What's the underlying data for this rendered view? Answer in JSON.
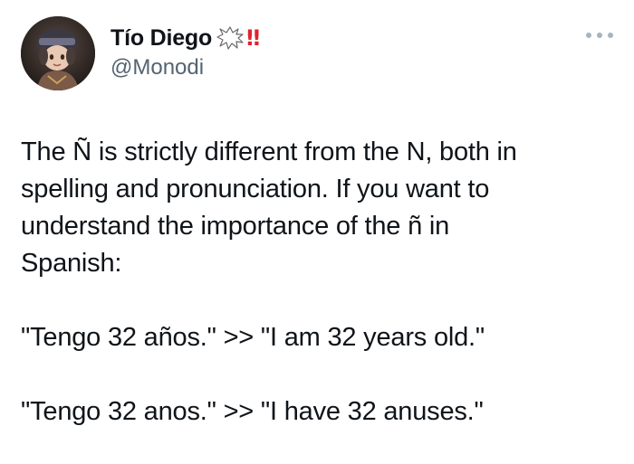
{
  "author": {
    "display_name": "Tío Diego",
    "emoji_burst_icon": "anger-speech-bubble-icon",
    "emoji_bang": "‼",
    "handle": "@Monodi"
  },
  "menu": {
    "icon": "more-horizontal-icon"
  },
  "tweet": {
    "lines": [
      "The Ñ is strictly different from the N, both in",
      "spelling and pronunciation. If you want to",
      "understand the importance of the ñ in",
      "Spanish:"
    ],
    "example_1": "\"Tengo 32 años.\" >> \"I am 32 years old.\"",
    "example_2": "\"Tengo 32 anos.\" >> \"I have 32 anuses.\""
  },
  "colors": {
    "text_primary": "#0f1419",
    "text_secondary": "#536471",
    "bang_red": "#e0242e"
  }
}
